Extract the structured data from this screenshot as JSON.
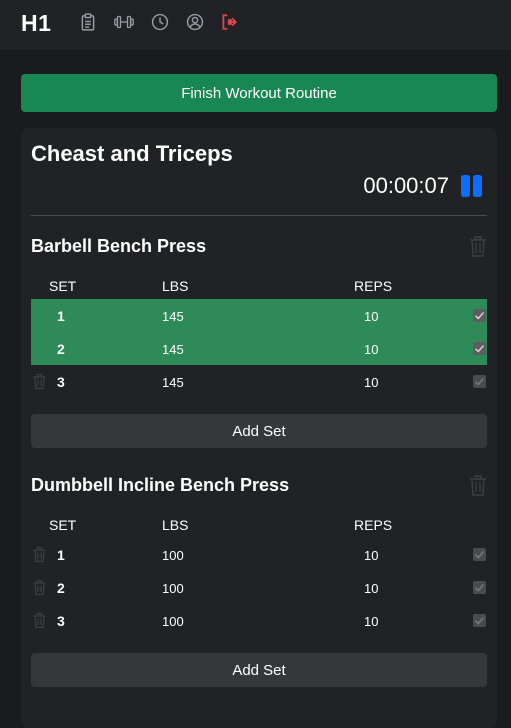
{
  "header": {
    "brand": "H1",
    "icons": [
      "clipboard-icon",
      "dumbbell-icon",
      "clock-icon",
      "user-circle-icon",
      "logout-icon"
    ],
    "logout_color": "#e0474c",
    "icon_color": "#9a9ba0"
  },
  "finish_button": {
    "label": "Finish Workout Routine",
    "color": "#198754"
  },
  "routine": {
    "title": "Cheast and Triceps",
    "timer": "00:00:07",
    "pause_color": "#0d6efd"
  },
  "columns": {
    "set": "SET",
    "lbs": "LBS",
    "reps": "REPS"
  },
  "exercises": [
    {
      "name": "Barbell Bench Press",
      "sets": [
        {
          "set": "1",
          "lbs": "145",
          "reps": "10",
          "completed": true
        },
        {
          "set": "2",
          "lbs": "145",
          "reps": "10",
          "completed": true
        },
        {
          "set": "3",
          "lbs": "145",
          "reps": "10",
          "completed": false
        }
      ],
      "add_label": "Add Set"
    },
    {
      "name": "Dumbbell Incline Bench Press",
      "sets": [
        {
          "set": "1",
          "lbs": "100",
          "reps": "10",
          "completed": false
        },
        {
          "set": "2",
          "lbs": "100",
          "reps": "10",
          "completed": false
        },
        {
          "set": "3",
          "lbs": "100",
          "reps": "10",
          "completed": false
        }
      ],
      "add_label": "Add Set"
    }
  ]
}
